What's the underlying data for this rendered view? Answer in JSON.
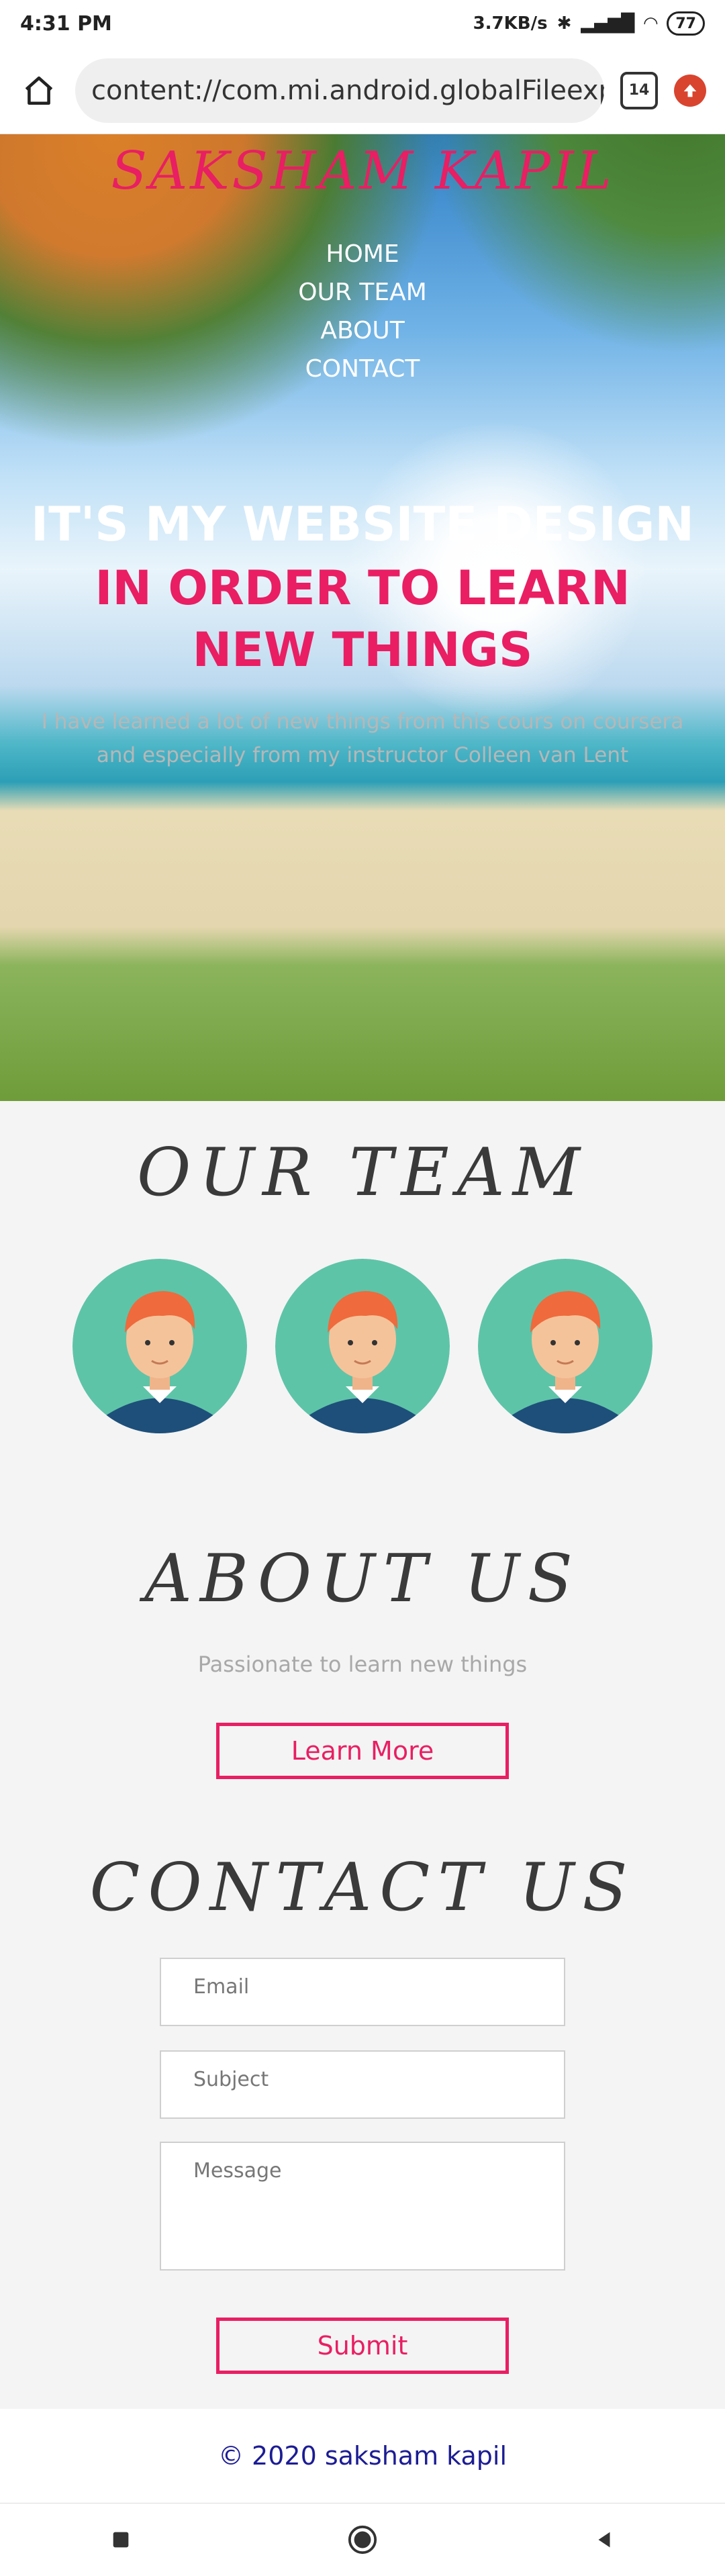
{
  "status_bar": {
    "time": "4:31 PM",
    "net_speed": "3.7KB/s",
    "battery": "77"
  },
  "browser": {
    "url": "content://com.mi.android.globalFileexplo",
    "tab_count": "14"
  },
  "site": {
    "brand": "SAKSHAM KAPIL",
    "nav": [
      "HOME",
      "OUR TEAM",
      "ABOUT",
      "CONTACT"
    ],
    "hero": {
      "title_line1": "IT'S MY WEBSITE DESIGN",
      "title_line2": "IN ORDER TO LEARN NEW THINGS",
      "description": "I have learned a lot of new things from this cours on coursera and especially from my instructor Colleen van Lent"
    },
    "team": {
      "title": "OUR  TEAM"
    },
    "about": {
      "title": "ABOUT  US",
      "text": "Passionate to learn new things",
      "button": "Learn More"
    },
    "contact": {
      "title": "CONTACT  US",
      "email_placeholder": "Email",
      "subject_placeholder": "Subject",
      "message_placeholder": "Message",
      "submit": "Submit"
    },
    "footer": "© 2020 saksham kapil"
  },
  "colors": {
    "accent": "#e91e63",
    "footer_text": "#1c1c94",
    "avatar_bg": "#5ec4a8"
  }
}
